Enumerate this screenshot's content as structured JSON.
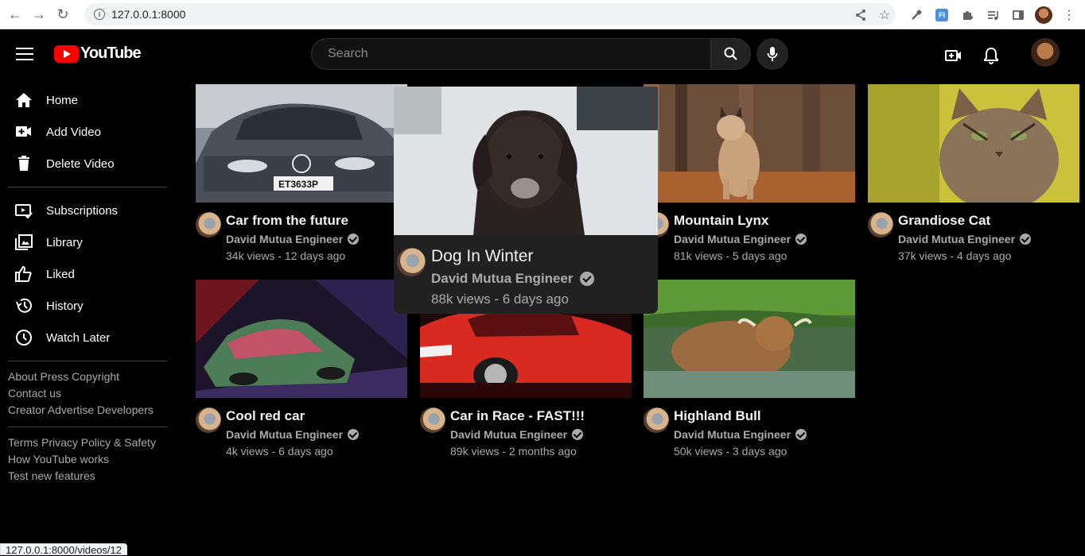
{
  "browser": {
    "url": "127.0.0.1:8000",
    "status_url": "127.0.0.1:8000/videos/12"
  },
  "header": {
    "logo_text": "YouTube",
    "search_placeholder": "Search"
  },
  "sidebar": {
    "primary": [
      {
        "label": "Home",
        "icon": "home-icon"
      },
      {
        "label": "Add Video",
        "icon": "add-video-icon"
      },
      {
        "label": "Delete Video",
        "icon": "trash-icon"
      }
    ],
    "secondary": [
      {
        "label": "Subscriptions",
        "icon": "subscriptions-icon"
      },
      {
        "label": "Library",
        "icon": "library-icon"
      },
      {
        "label": "Liked",
        "icon": "thumbs-up-icon"
      },
      {
        "label": "History",
        "icon": "history-icon"
      },
      {
        "label": "Watch Later",
        "icon": "clock-icon"
      }
    ],
    "footer1": [
      "About Press Copyright",
      "Contact us",
      "Creator Advertise Developers"
    ],
    "footer2": [
      "Terms Privacy Policy & Safety",
      "How YouTube works",
      "Test new features"
    ]
  },
  "videos": [
    {
      "title": "Car from the future",
      "channel": "David Mutua Engineer",
      "stats": "34k views - 12 days ago"
    },
    {
      "title": "Dog In Winter",
      "channel": "David Mutua Engineer",
      "stats": "88k views - 6 days ago"
    },
    {
      "title": "Mountain Lynx",
      "channel": "David Mutua Engineer",
      "stats": "81k views - 5 days ago"
    },
    {
      "title": "Grandiose Cat",
      "channel": "David Mutua Engineer",
      "stats": "37k views - 4 days ago"
    },
    {
      "title": "Cool red car",
      "channel": "David Mutua Engineer",
      "stats": "4k views - 6 days ago"
    },
    {
      "title": "Car in Race - FAST!!!",
      "channel": "David Mutua Engineer",
      "stats": "89k views - 2 months ago"
    },
    {
      "title": "Highland Bull",
      "channel": "David Mutua Engineer",
      "stats": "50k views - 3 days ago"
    }
  ],
  "colors": {
    "background": "#000000",
    "brand_red": "#ff0000",
    "secondary_text": "#aaaaaa"
  }
}
